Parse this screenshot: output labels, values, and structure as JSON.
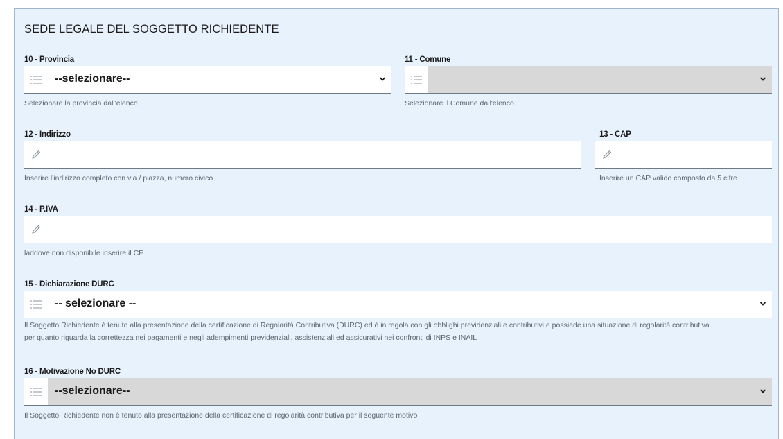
{
  "section": {
    "title": "SEDE LEGALE DEL SOGGETTO RICHIEDENTE"
  },
  "fields": {
    "provincia": {
      "label": "10 - Provincia",
      "value": "--selezionare--",
      "help": "Selezionare la provincia dall'elenco"
    },
    "comune": {
      "label": "11 - Comune",
      "value": "",
      "help": "Selezionare il Comune dall'elenco"
    },
    "indirizzo": {
      "label": "12 - Indirizzo",
      "value": "",
      "help": "Inserire l'indirizzo completo con via / piazza, numero civico"
    },
    "cap": {
      "label": "13 - CAP",
      "value": "",
      "help": "Inserire un CAP valido composto da 5 cifre"
    },
    "piva": {
      "label": "14 - P.IVA",
      "value": "",
      "help": "laddove non disponibile inserire il CF"
    },
    "durc": {
      "label": "15 - Dichiarazione DURC",
      "value": "-- selezionare --",
      "help_line1": "Il Soggetto Richiedente è tenuto alla presentazione della certificazione di Regolarità Contributiva (DURC) ed è in regola con gli obblighi previdenziali e contributivi e possiede una situazione di regolarità contributiva",
      "help_line2": "per quanto riguarda la correttezza nei pagamenti e negli adempimenti previdenziali, assistenziali ed assicurativi nei confronti di INPS e INAIL"
    },
    "motivazione": {
      "label": "16 - Motivazione No DURC",
      "value": "--selezionare--",
      "help": "Il Soggetto Richiedente non è tenuto alla presentazione della certificazione di regolarità contributiva per il seguente motivo"
    }
  },
  "icons": {
    "list": "list-icon",
    "pencil": "pencil-icon",
    "chevron": "chevron-down-icon"
  },
  "colors": {
    "panel_bg": "#e8f2fd",
    "disabled_bg": "#d8d8d8",
    "help_text": "#5d6670",
    "icon": "#8a93a0"
  }
}
